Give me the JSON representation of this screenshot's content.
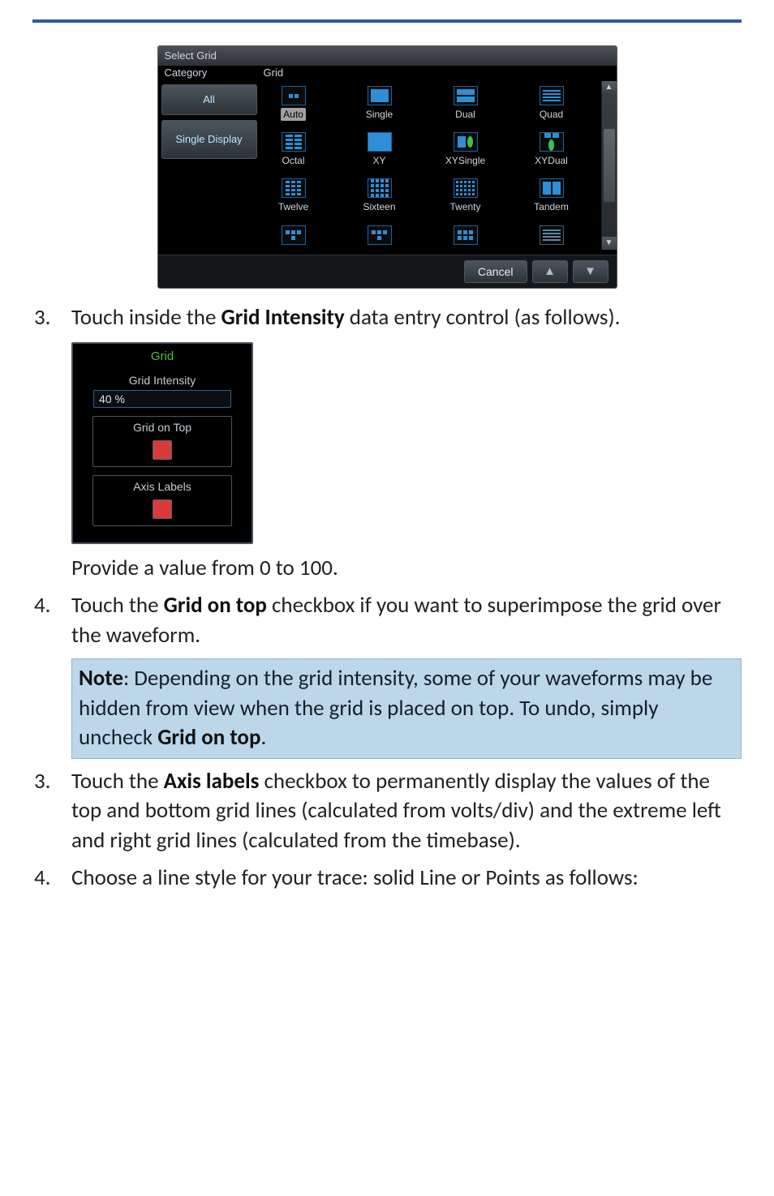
{
  "select_grid": {
    "title": "Select Grid",
    "header_left": "Category",
    "header_right": "Grid",
    "categories": [
      "All",
      "Single Display"
    ],
    "grid_items": [
      [
        "Auto",
        "Single",
        "Dual",
        "Quad"
      ],
      [
        "Octal",
        "XY",
        "XYSingle",
        "XYDual"
      ],
      [
        "Twelve",
        "Sixteen",
        "Twenty",
        "Tandem"
      ],
      [
        "",
        "",
        "",
        ""
      ]
    ],
    "cancel": "Cancel"
  },
  "grid_panel": {
    "title": "Grid",
    "intensity_label": "Grid Intensity",
    "intensity_value": "40 %",
    "on_top_label": "Grid on Top",
    "axis_label": "Axis Labels"
  },
  "steps": {
    "s3a_pre": "Touch inside the ",
    "s3a_bold": "Grid Intensity",
    "s3a_post": " data entry control (as follows).",
    "s3a_sub": "Provide a value from 0 to 100.",
    "s4a_pre": "Touch the ",
    "s4a_bold": "Grid on top",
    "s4a_post": " checkbox if you want to superimpose the grid over the waveform.",
    "s3b_pre": "Touch the ",
    "s3b_bold": "Axis labels",
    "s3b_post": " checkbox to permanently display the values of the top and bottom grid lines (calculated from volts/div) and the extreme left and right grid lines (calculated from the timebase).",
    "s4b": "Choose a line style for your trace: solid Line or Points as follows:"
  },
  "numbers": {
    "n3": "3.",
    "n4": "4."
  },
  "note": {
    "lead": "Note",
    "body1": ": Depending on the grid intensity, some of your waveforms may be hidden from view when the grid is placed on top. To undo, simply uncheck ",
    "bold": "Grid on top",
    "body2": "."
  }
}
